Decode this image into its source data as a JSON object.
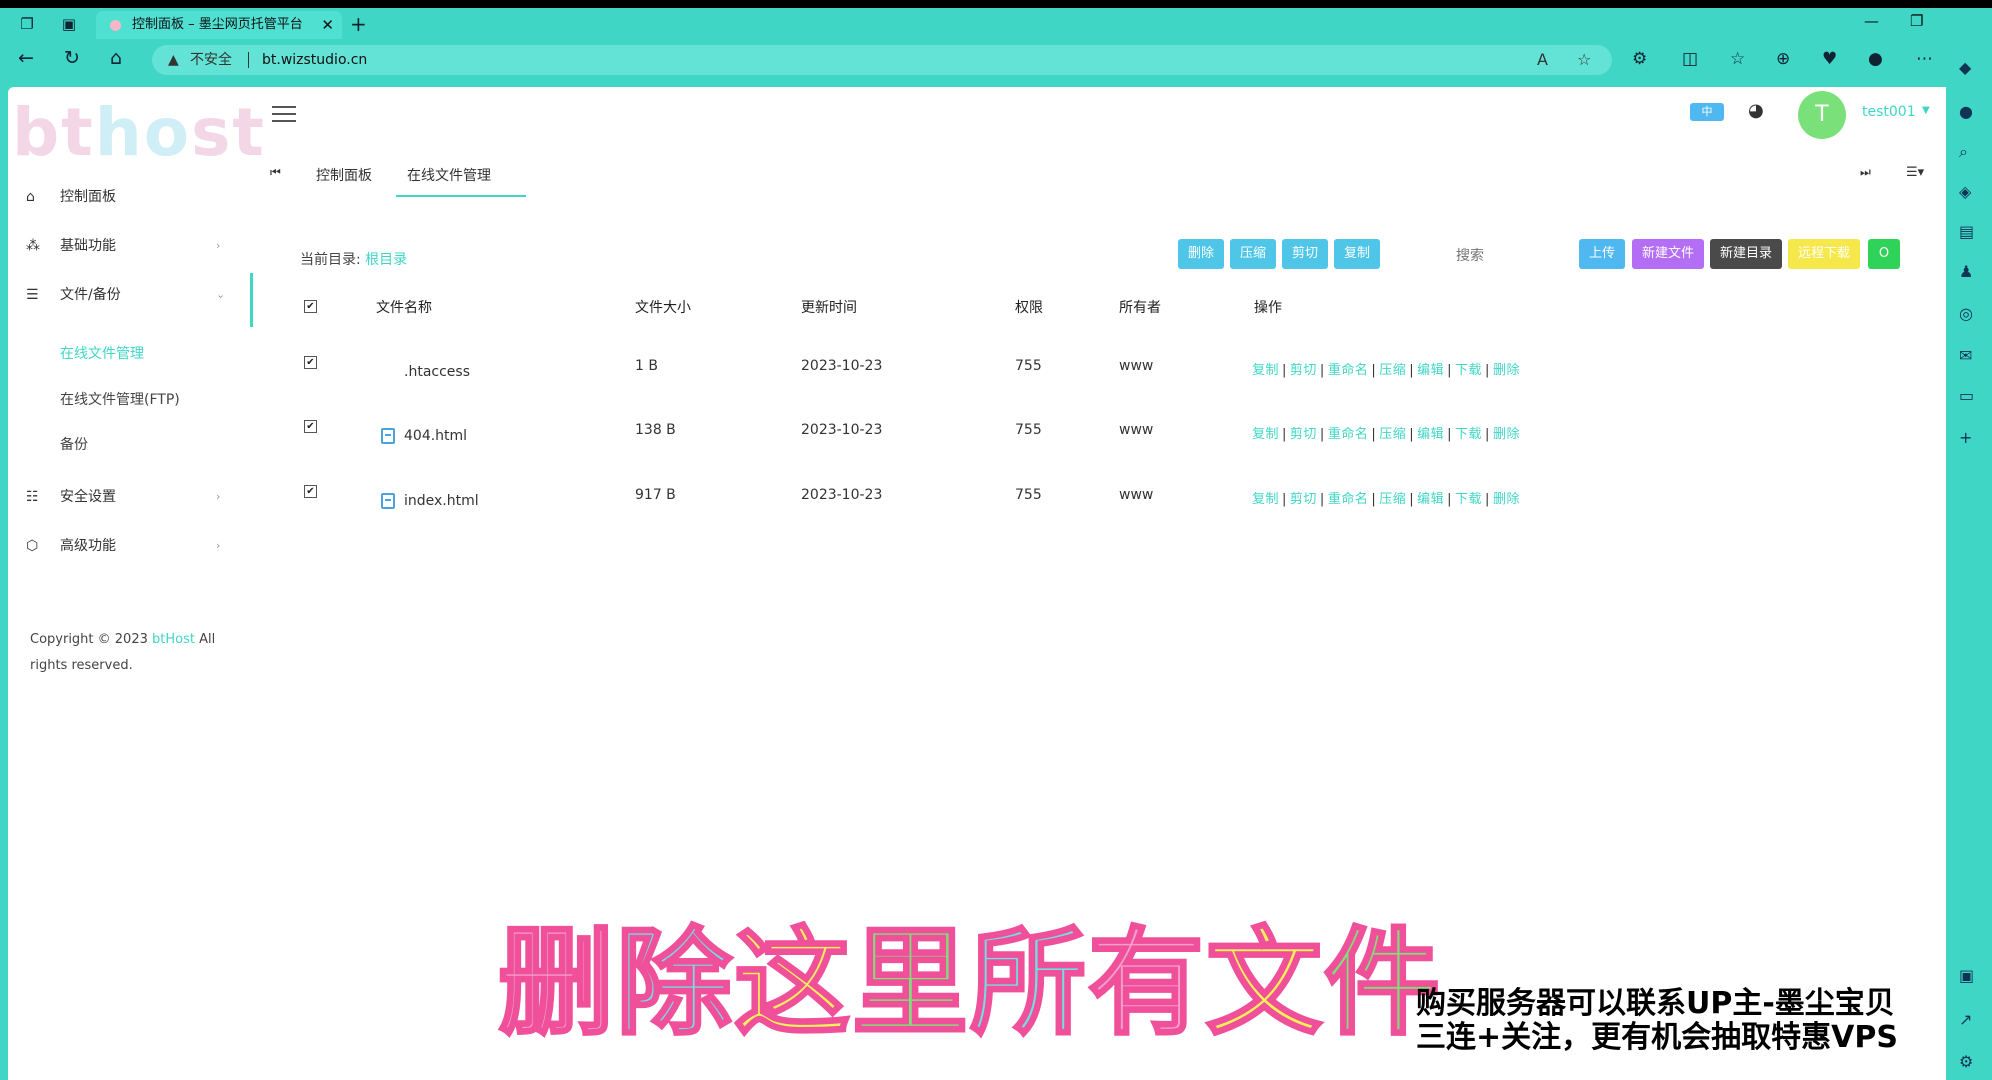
{
  "browser": {
    "tab_title": "控制面板 – 墨尘网页托管平台",
    "not_secure": "不安全",
    "url": "bt.wizstudio.cn"
  },
  "app": {
    "logo": "bthost",
    "user": "test001",
    "avatar_letter": "T",
    "lang_badge": "中"
  },
  "sidebar": {
    "items": [
      {
        "label": "控制面板",
        "icon": "home-icon"
      },
      {
        "label": "基础功能",
        "icon": "dots-icon"
      },
      {
        "label": "文件/备份",
        "icon": "list-icon"
      },
      {
        "label": "安全设置",
        "icon": "sliders-icon"
      },
      {
        "label": "高级功能",
        "icon": "cube-icon"
      }
    ],
    "sub_items": [
      "在线文件管理",
      "在线文件管理(FTP)",
      "备份"
    ],
    "copyright_prefix": "Copyright © 2023 ",
    "copyright_brand": "btHost",
    "copyright_suffix": " All rights reserved."
  },
  "tabs": [
    "控制面板",
    "在线文件管理"
  ],
  "filebar": {
    "current_dir_label": "当前目录:",
    "current_dir": "根目录",
    "search_placeholder": "搜索",
    "actions": [
      "删除",
      "压缩",
      "剪切",
      "复制"
    ],
    "tools": [
      "上传",
      "新建文件",
      "新建目录",
      "远程下载",
      "O"
    ]
  },
  "table": {
    "headers": [
      "文件名称",
      "文件大小",
      "更新时间",
      "权限",
      "所有者",
      "操作"
    ],
    "rows": [
      {
        "name": ".htaccess",
        "size": "1 B",
        "date": "2023-10-23",
        "perm": "755",
        "owner": "www"
      },
      {
        "name": "404.html",
        "size": "138 B",
        "date": "2023-10-23",
        "perm": "755",
        "owner": "www"
      },
      {
        "name": "index.html",
        "size": "917 B",
        "date": "2023-10-23",
        "perm": "755",
        "owner": "www"
      }
    ],
    "ops": [
      "复制",
      "剪切",
      "重命名",
      "压缩",
      "编辑",
      "下载",
      "删除"
    ]
  },
  "overlay": {
    "caption_chars": [
      "删",
      "除",
      "这",
      "里",
      "所",
      "有",
      "文",
      "件"
    ],
    "promo_line1": "购买服务器可以联系UP主-墨尘宝贝",
    "promo_line2": "三连+关注，更有机会抽取特惠VPS"
  },
  "colors": {
    "accent": "#3fd6c6",
    "purple": "#b36ef5",
    "dark": "#4a4a4a",
    "yellow": "#f6e84a",
    "green": "#2fd35a",
    "blue": "#4fb8f0"
  }
}
